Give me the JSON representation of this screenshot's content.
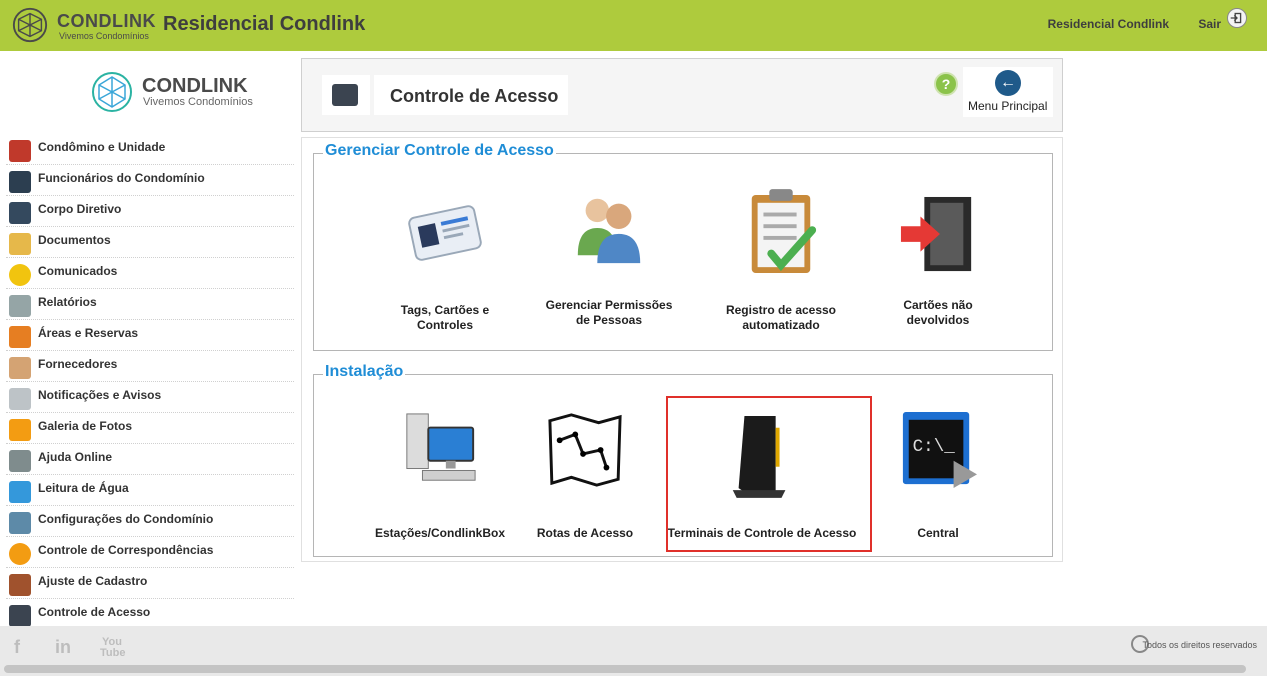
{
  "header": {
    "brand": "CONDLINK",
    "tagline": "Vivemos Condomínios",
    "title": "Residencial Condlink",
    "user_name": "Residencial Condlink",
    "logout": "Sair"
  },
  "sidebar": {
    "brand": "CONDLINK",
    "tagline": "Vivemos Condomínios",
    "items": [
      {
        "label": "Condômino e Unidade",
        "color": "#c0392b"
      },
      {
        "label": "Funcionários do Condomínio",
        "color": "#2c3e50"
      },
      {
        "label": "Corpo Diretivo",
        "color": "#34495e"
      },
      {
        "label": "Documentos",
        "color": "#e6b84a"
      },
      {
        "label": "Comunicados",
        "color": "#f1c40f"
      },
      {
        "label": "Relatórios",
        "color": "#95a5a6"
      },
      {
        "label": "Áreas e Reservas",
        "color": "#e67e22"
      },
      {
        "label": "Fornecedores",
        "color": "#d4a373"
      },
      {
        "label": "Notificações e Avisos",
        "color": "#bdc3c7"
      },
      {
        "label": "Galeria de Fotos",
        "color": "#f39c12"
      },
      {
        "label": "Ajuda Online",
        "color": "#7f8c8d"
      },
      {
        "label": "Leitura de Água",
        "color": "#3498db"
      },
      {
        "label": "Configurações do Condomínio",
        "color": "#5d8aa8"
      },
      {
        "label": "Controle de Correspondências",
        "color": "#f39c12"
      },
      {
        "label": "Ajuste de Cadastro",
        "color": "#a0522d"
      },
      {
        "label": "Controle de Acesso",
        "color": "#3b4450"
      }
    ]
  },
  "page": {
    "title": "Controle de Acesso",
    "menu_principal": "Menu Principal"
  },
  "sections": {
    "gerenciar": {
      "title": "Gerenciar Controle de Acesso",
      "tiles": [
        {
          "label_line1": "Tags, Cartões e",
          "label_line2": "Controles",
          "icon": "id-card-icon"
        },
        {
          "label_line1": "Gerenciar Permissões",
          "label_line2": "de Pessoas",
          "icon": "people-icon"
        },
        {
          "label_line1": "Registro de acesso",
          "label_line2": "automatizado",
          "icon": "clipboard-check-icon"
        },
        {
          "label_line1": "Cartões não",
          "label_line2": "devolvidos",
          "icon": "exit-door-icon"
        }
      ]
    },
    "instalacao": {
      "title": "Instalação",
      "tiles": [
        {
          "label": "Estações/CondlinkBox",
          "icon": "workstation-icon"
        },
        {
          "label": "Rotas de Acesso",
          "icon": "map-icon"
        },
        {
          "label": "Terminais de Controle de Acesso",
          "icon": "terminal-device-icon"
        },
        {
          "label": "Central",
          "icon": "console-icon"
        }
      ]
    }
  },
  "footer": {
    "rights": "Todos os direitos reservados",
    "facebook": "f",
    "linkedin": "in",
    "youtube": "You Tube"
  }
}
